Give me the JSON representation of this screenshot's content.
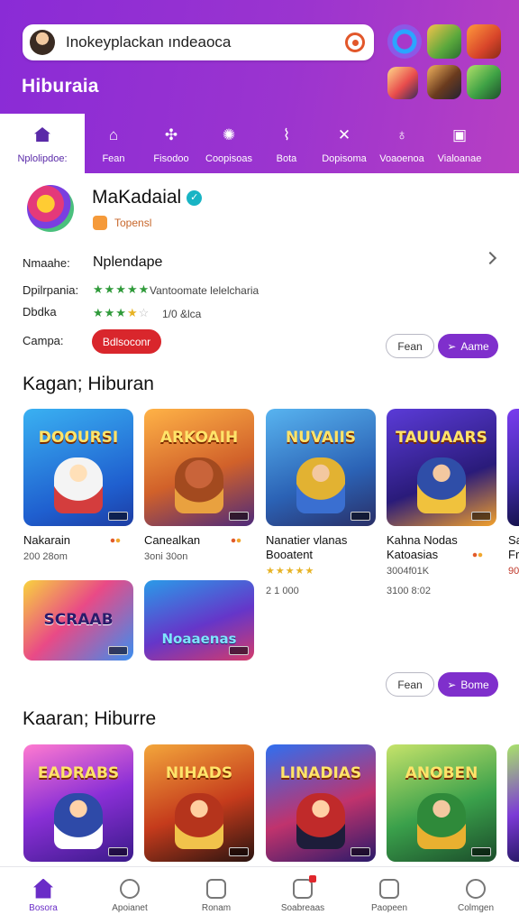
{
  "header": {
    "search_query": "Inokeyplackan ındeaoca",
    "brand": "Hiburaia",
    "icons": [
      "avatar",
      "search-icon",
      "ring-app-icon",
      "game-icon",
      "game-icon",
      "game-icon",
      "game-icon",
      "game-icon"
    ]
  },
  "tabs": [
    {
      "label": "Nplolipdoe:",
      "icon": "home-icon",
      "glyph": ""
    },
    {
      "label": "Fean",
      "icon": "house-outline-icon",
      "glyph": "⌂"
    },
    {
      "label": "Fisodoo",
      "icon": "gamepad-icon",
      "glyph": "✣"
    },
    {
      "label": "Coopisoas",
      "icon": "sun-icon",
      "glyph": "✺"
    },
    {
      "label": "Bota",
      "icon": "chart-icon",
      "glyph": "⌇"
    },
    {
      "label": "Dopisoma",
      "icon": "cross-icon",
      "glyph": "✕"
    },
    {
      "label": "Voaoenoa",
      "icon": "pin-icon",
      "glyph": "♁"
    },
    {
      "label": "Vialoanae",
      "icon": "image-icon",
      "glyph": "▣"
    }
  ],
  "featured": {
    "name": "MaKadaial",
    "verified_glyph": "✓",
    "subtitle": "Topensl",
    "rows": {
      "row1_label": "Nmaahe:",
      "row1_value": "Nplendape",
      "row2_label": "Dpilrpania:",
      "row2_stars": "★★★★★",
      "row2_text": "Vantoomate lelelcharia",
      "row3_label": "Dbdka",
      "row3_stars_green": "★★★",
      "row3_stars_yellow": "★",
      "row3_stars_empty": "☆",
      "row3_text": "1/0 &lca",
      "row4_label": "Campa:",
      "row4_pill": "Bdlsoconr"
    },
    "btn_outline": "Fean",
    "btn_fill": "Aame"
  },
  "section1": {
    "title": "Kagan; Hiburan",
    "cards": [
      {
        "art": "DOOURSI",
        "title": "Nakarain",
        "title2": "",
        "meta": "200 28om",
        "stars": ""
      },
      {
        "art": "ARKOAIH",
        "title": "Canealkan",
        "title2": "",
        "meta": "3oni 30on",
        "stars": ""
      },
      {
        "art": "NUVAIIS",
        "title": "Nanatier vlanas",
        "title2": "Booatent",
        "meta": "2 1 000",
        "stars": "★★★★★"
      },
      {
        "art": "TAUUAARS",
        "title": "Kahna Nodas",
        "title2": "Katoasias",
        "meta": "3004f01K",
        "meta2": "3100 8:02",
        "stars": ""
      },
      {
        "art": "",
        "title": "Sa",
        "title2": "Fr",
        "meta": "90",
        "stars": ""
      }
    ],
    "row2_cards": [
      {
        "art": "SCRAAB"
      },
      {
        "art": "Noaaenas"
      }
    ],
    "btn_outline": "Fean",
    "btn_fill": "Bome"
  },
  "section2": {
    "title": "Kaaran; Hiburre",
    "cards": [
      {
        "art": "EADRABS"
      },
      {
        "art": "NIHADS"
      },
      {
        "art": "LINADIAS"
      },
      {
        "art": "ANOBEN"
      },
      {
        "art": ""
      }
    ]
  },
  "bottom_nav": [
    {
      "label": "Bosora",
      "icon": "home-icon"
    },
    {
      "label": "Apoianet",
      "icon": "face-icon"
    },
    {
      "label": "Ronam",
      "icon": "chat-icon"
    },
    {
      "label": "Soabreaas",
      "icon": "notification-icon"
    },
    {
      "label": "Paopeen",
      "icon": "message-icon"
    },
    {
      "label": "Colmgen",
      "icon": "profile-icon"
    }
  ]
}
